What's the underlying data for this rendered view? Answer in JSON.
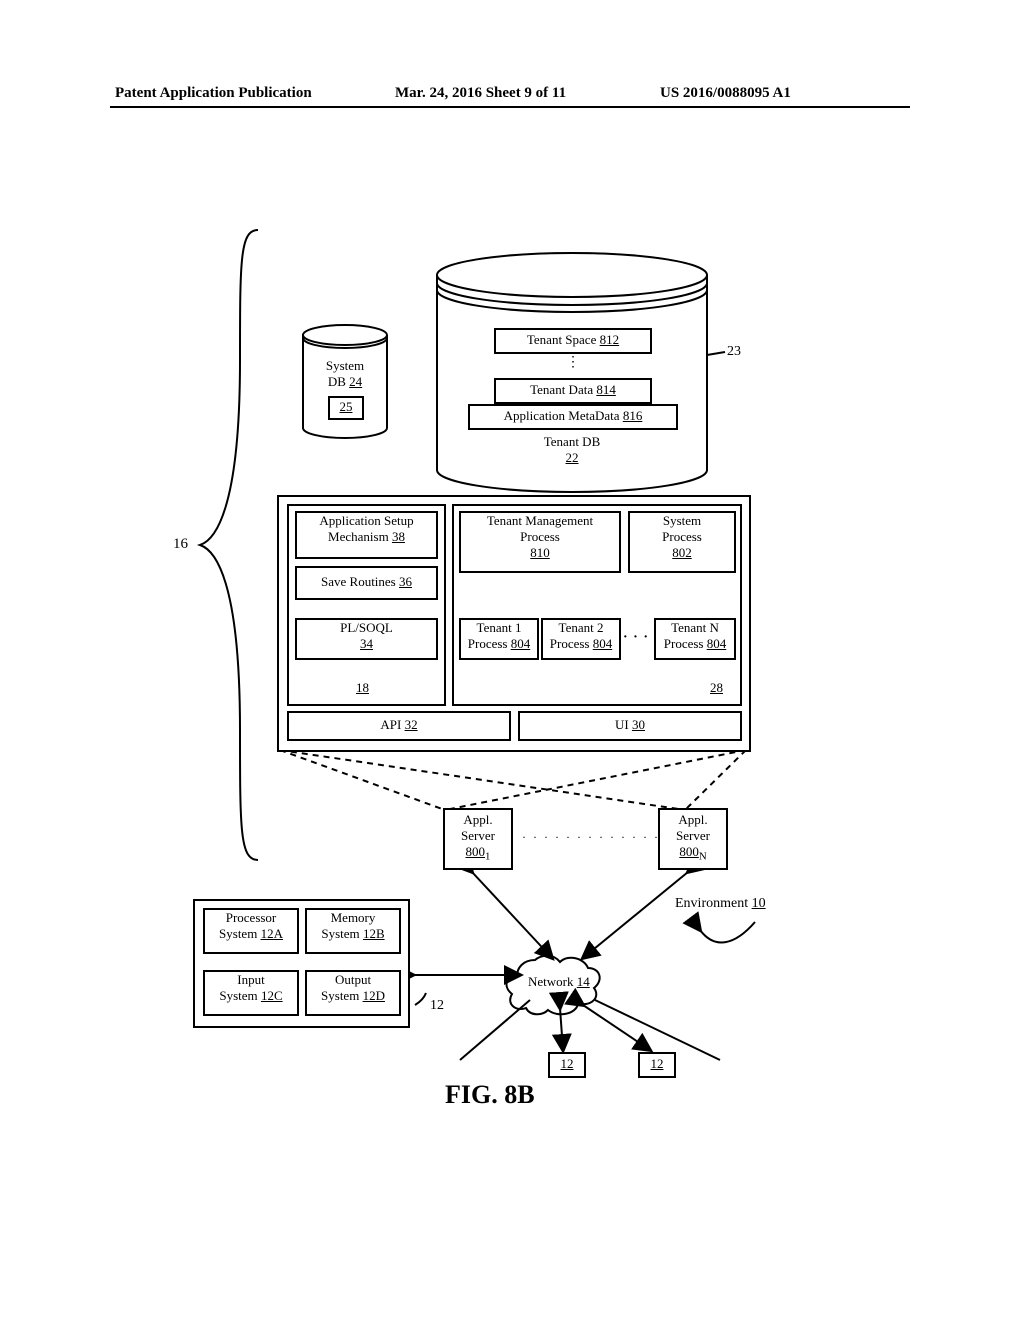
{
  "header": {
    "left": "Patent Application Publication",
    "center": "Mar. 24, 2016  Sheet 9 of 11",
    "right": "US 2016/0088095 A1"
  },
  "brace_label": "16",
  "cylinders": {
    "system_db": {
      "title": "System",
      "subtitle": "DB",
      "ref": "24",
      "inner_ref": "25"
    },
    "tenant_db": {
      "title": "Tenant DB",
      "ref": "22",
      "tenant_space": {
        "label": "Tenant Space",
        "ref": "812"
      },
      "tenant_data": {
        "label": "Tenant Data",
        "ref": "814"
      },
      "app_meta": {
        "label": "Application MetaData",
        "ref": "816"
      }
    },
    "callout_23": "23"
  },
  "platform": {
    "left_panel": {
      "app_setup": {
        "l1": "Application Setup",
        "l2": "Mechanism",
        "ref": "38"
      },
      "save": {
        "label": "Save Routines",
        "ref": "36"
      },
      "plsoql": {
        "label": "PL/SOQL",
        "ref": "34"
      },
      "panel_ref": "18"
    },
    "right_panel": {
      "tmp": {
        "l1": "Tenant Management",
        "l2": "Process",
        "ref": "810"
      },
      "sp": {
        "l1": "System",
        "l2": "Process",
        "ref": "802"
      },
      "t1": {
        "l1": "Tenant 1",
        "l2": "Process",
        "ref": "804"
      },
      "t2": {
        "l1": "Tenant 2",
        "l2": "Process",
        "ref": "804"
      },
      "tn": {
        "l1": "Tenant N",
        "l2": "Process",
        "ref": "804"
      },
      "dots": "· · ·",
      "panel_ref": "28"
    },
    "api": {
      "label": "API",
      "ref": "32"
    },
    "ui": {
      "label": "UI",
      "ref": "30"
    }
  },
  "servers": {
    "s1": {
      "l1": "Appl.",
      "l2": "Server",
      "ref": "800",
      "sub": "1"
    },
    "sn": {
      "l1": "Appl.",
      "l2": "Server",
      "ref": "800",
      "sub": "N"
    },
    "dots": "· · · · · · · · · · · · · ·"
  },
  "env": {
    "label": "Environment",
    "ref": "10"
  },
  "network": {
    "label": "Network",
    "ref": "14"
  },
  "client_box": {
    "proc": {
      "l1": "Processor",
      "l2": "System",
      "ref": "12A"
    },
    "mem": {
      "l1": "Memory",
      "l2": "System",
      "ref": "12B"
    },
    "inp": {
      "l1": "Input",
      "l2": "System",
      "ref": "12C"
    },
    "out": {
      "l1": "Output",
      "l2": "System",
      "ref": "12D"
    },
    "callout_12": "12"
  },
  "client_nodes": {
    "a": "12",
    "b": "12"
  },
  "figure": "FIG. 8B"
}
